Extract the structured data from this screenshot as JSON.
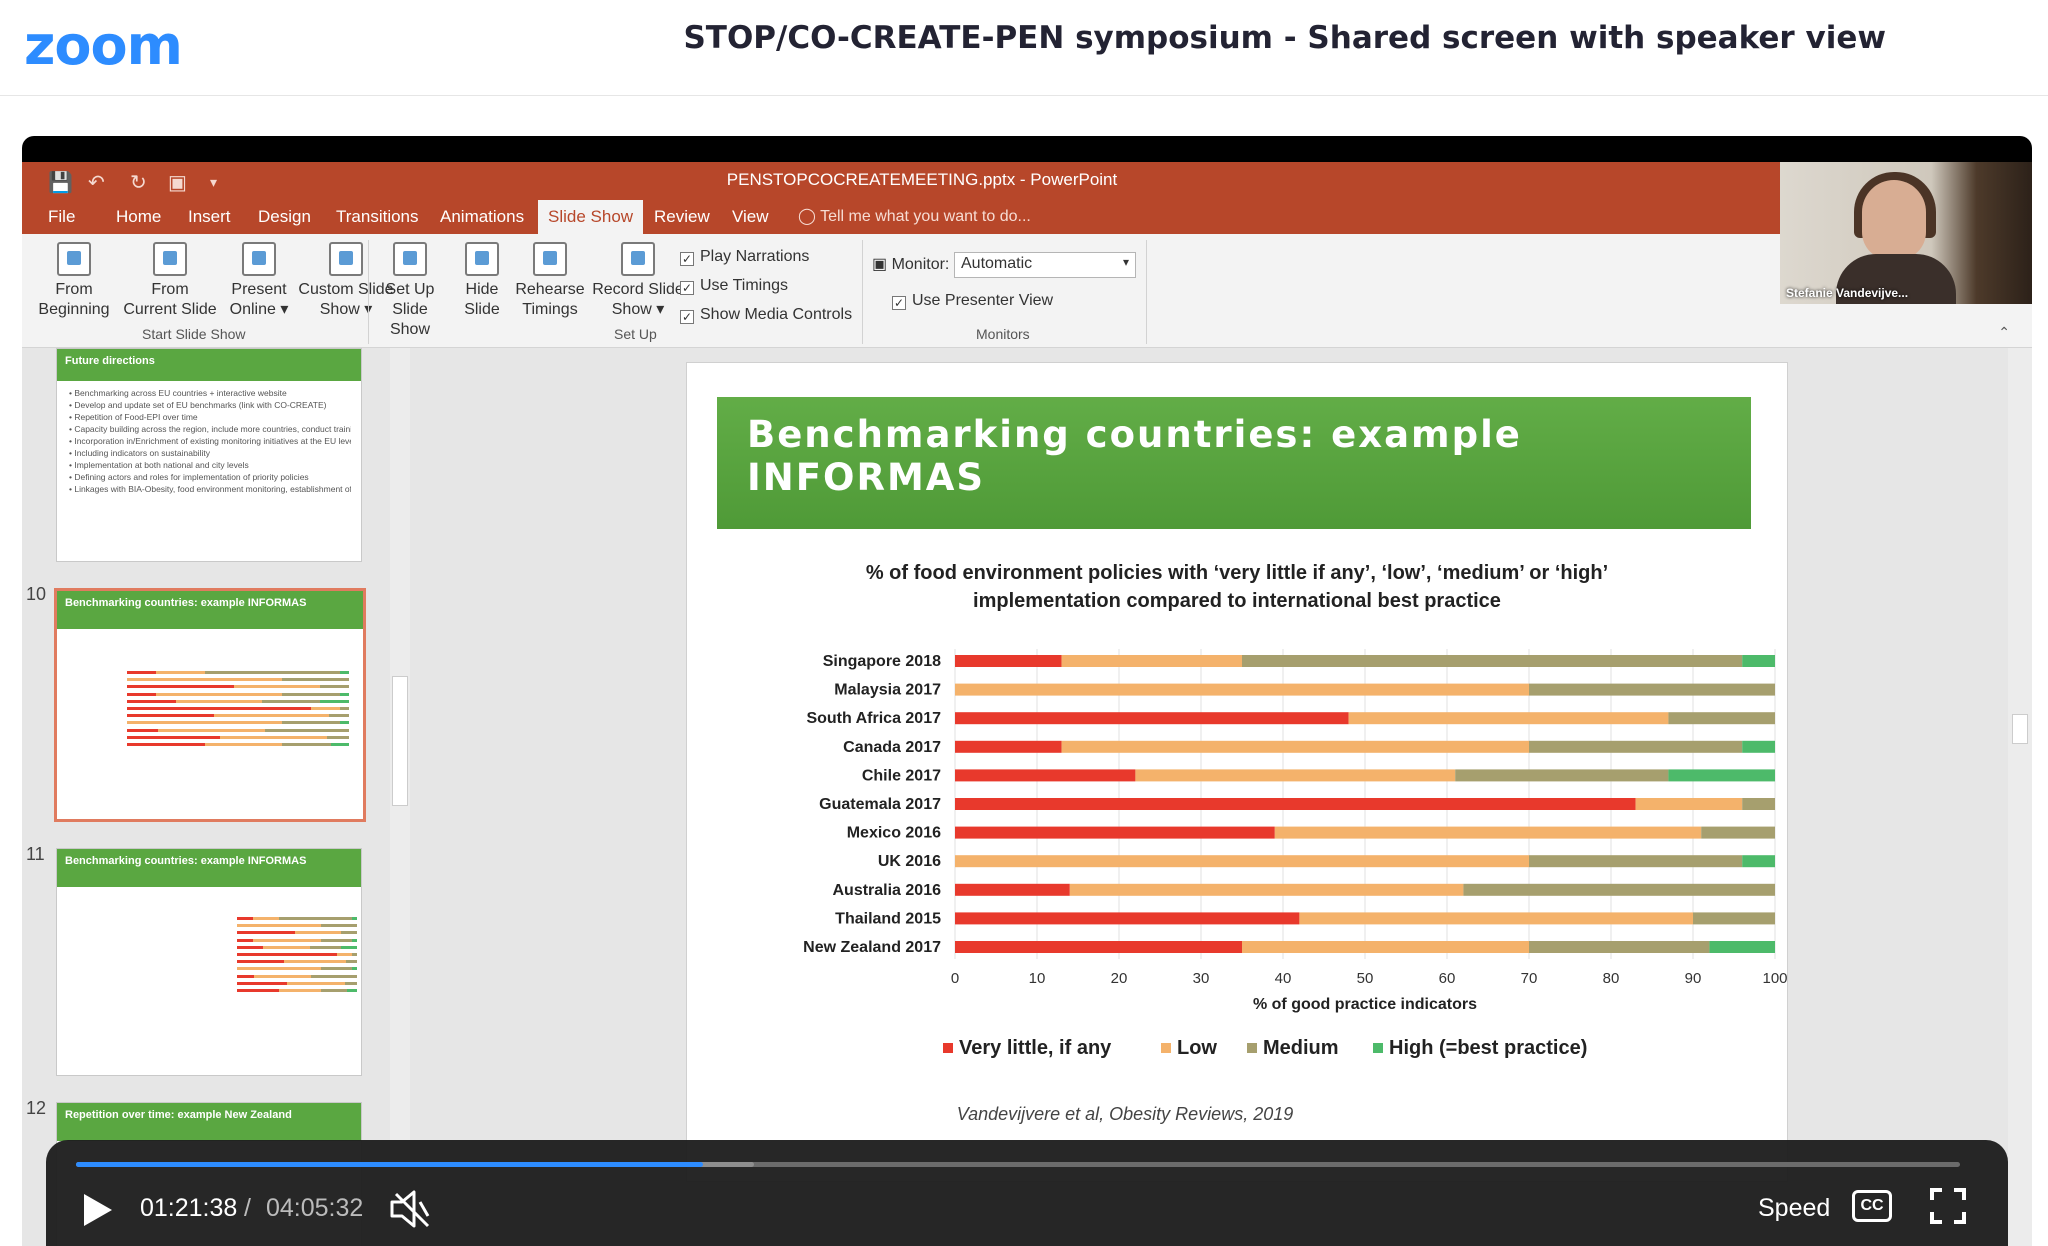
{
  "zoom": {
    "logo": "zoom",
    "title": "STOP/CO-CREATE-PEN symposium - Shared screen with speaker view"
  },
  "powerpoint": {
    "filename": "PENSTOPCOCREATEMEETING.pptx - PowerPoint",
    "tabs": [
      "File",
      "Home",
      "Insert",
      "Design",
      "Transitions",
      "Animations",
      "Slide Show",
      "Review",
      "View"
    ],
    "active_tab": "Slide Show",
    "tell_me": "Tell me what you want to do...",
    "ribbon": {
      "from_beginning": [
        "From",
        "Beginning"
      ],
      "from_current": [
        "From",
        "Current Slide"
      ],
      "present_online": [
        "Present",
        "Online ▾"
      ],
      "custom_show": [
        "Custom Slide",
        "Show ▾"
      ],
      "set_up": [
        "Set Up",
        "Slide Show"
      ],
      "hide_slide": [
        "Hide",
        "Slide"
      ],
      "rehearse": [
        "Rehearse",
        "Timings"
      ],
      "record": [
        "Record Slide",
        "Show ▾"
      ],
      "play_narrations": "Play Narrations",
      "use_timings": "Use Timings",
      "show_media_controls": "Show Media Controls",
      "monitor_label": "Monitor:",
      "monitor_value": "Automatic",
      "use_presenter_view": "Use Presenter View",
      "groups": [
        "Start Slide Show",
        "Set Up",
        "Monitors"
      ]
    },
    "thumbnails": [
      {
        "number": "",
        "title": "Future directions",
        "bullets": [
          "Benchmarking across EU countries + interactive website",
          "Develop and update set of EU benchmarks (link with CO-CREATE)",
          "Repetition of Food-EPI over time",
          "Capacity building across the region, include more countries, conduct training and provide support",
          "Incorporation in/Enrichment of existing monitoring initiatives at the EU level",
          "Including indicators on sustainability",
          "Implementation at both national and city levels",
          "Defining actors and roles for implementation of priority policies",
          "Linkages with BIA-Obesity, food environment monitoring, establishment of INFORMAS Europe network www.informas-europe.org"
        ]
      },
      {
        "number": "10",
        "title": "Benchmarking countries: example INFORMAS"
      },
      {
        "number": "11",
        "title": "Benchmarking countries: example INFORMAS"
      },
      {
        "number": "12",
        "title": "Repetition over time: example New Zealand"
      }
    ],
    "slide": {
      "title": "Benchmarking countries: example INFORMAS",
      "citation": "Vandevijvere et al, Obesity Reviews, 2019"
    }
  },
  "chart_data": {
    "type": "bar",
    "stacked": true,
    "orientation": "horizontal",
    "title": "% of food environment policies with ‘very little if any’, ‘low’, ‘medium’ or ‘high’ implementation compared to international best practice",
    "xlabel": "% of good practice indicators",
    "xlim": [
      0,
      100
    ],
    "xticks": [
      0,
      10,
      20,
      30,
      40,
      50,
      60,
      70,
      80,
      90,
      100
    ],
    "legend_position": "bottom",
    "categories": [
      "Singapore 2018",
      "Malaysia 2017",
      "South Africa 2017",
      "Canada 2017",
      "Chile 2017",
      "Guatemala 2017",
      "Mexico 2016",
      "UK 2016",
      "Australia 2016",
      "Thailand 2015",
      "New Zealand 2017"
    ],
    "series": [
      {
        "name": "Very little, if any",
        "color": "#E8392C",
        "values": [
          13,
          0,
          48,
          13,
          22,
          83,
          39,
          0,
          14,
          42,
          35
        ]
      },
      {
        "name": "Low",
        "color": "#F4B26B",
        "values": [
          22,
          70,
          39,
          57,
          39,
          13,
          52,
          70,
          48,
          48,
          35
        ]
      },
      {
        "name": "Medium",
        "color": "#A69F6E",
        "values": [
          61,
          30,
          13,
          26,
          26,
          4,
          9,
          26,
          38,
          10,
          22
        ]
      },
      {
        "name": "High (=best practice)",
        "color": "#4DBA6A",
        "values": [
          4,
          0,
          0,
          4,
          13,
          0,
          0,
          4,
          0,
          0,
          8
        ]
      }
    ]
  },
  "speaker": {
    "name": "Stefanie Vandevijve..."
  },
  "player": {
    "current_time": "01:21:38",
    "separator": "/",
    "total_time": "04:05:32",
    "progress": 0.333,
    "buffered": 0.36,
    "speed_label": "Speed",
    "cc_label": "CC",
    "accent_color": "#2D8CFF"
  }
}
